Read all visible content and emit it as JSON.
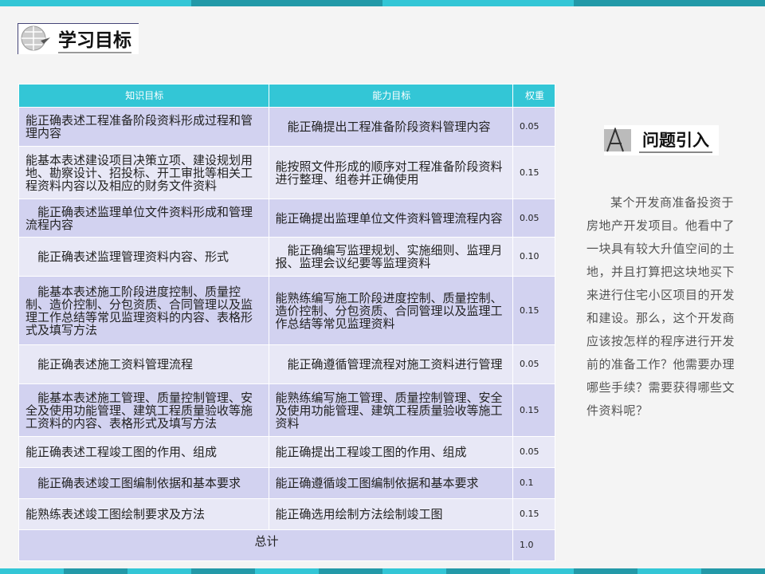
{
  "header": {
    "title": "学习目标"
  },
  "table": {
    "headers": [
      "知识目标",
      "能力目标",
      "权重"
    ],
    "rows": [
      {
        "knowledge": "能正确表述工程准备阶段资料形成过程和管理内容",
        "ability": "　能正确提出工程准备阶段资料管理内容",
        "weight": "0.05"
      },
      {
        "knowledge": "能基本表述建设项目决策立项、建设规划用地、勘察设计、招投标、开工审批等相关工程资料内容以及相应的财务文件资料",
        "ability": "能按照文件形成的顺序对工程准备阶段资料进行整理、组卷并正确使用",
        "weight": "0.15"
      },
      {
        "knowledge": "　能正确表述监理单位文件资料形成和管理流程内容",
        "ability": "能正确提出监理单位文件资料管理流程内容",
        "weight": "0.05"
      },
      {
        "knowledge": "　能正确表述监理管理资料内容、形式",
        "ability": "　能正确编写监理规划、实施细则、监理月报、监理会议纪要等监理资料",
        "weight": "0.10"
      },
      {
        "knowledge": "　能基本表述施工阶段进度控制、质量控制、造价控制、分包资质、合同管理以及监理工作总结等常见监理资料的内容、表格形式及填写方法",
        "ability": "能熟练编写施工阶段进度控制、质量控制、造价控制、分包资质、合同管理以及监理工作总结等常见监理资料",
        "weight": "0.15"
      },
      {
        "knowledge": "　能正确表述施工资料管理流程",
        "ability": "　能正确遵循管理流程对施工资料进行管理",
        "weight": "0.05"
      },
      {
        "knowledge": "　能基本表述施工管理、质量控制管理、安全及使用功能管理、建筑工程质量验收等施工资料的内容、表格形式及填写方法",
        "ability": "能熟练编写施工管理、质量控制管理、安全及使用功能管理、建筑工程质量验收等施工资料",
        "weight": "0.15"
      },
      {
        "knowledge": "能正确表述工程竣工图的作用、组成",
        "ability": "能正确提出工程竣工图的作用、组成",
        "weight": "0.05"
      },
      {
        "knowledge": "　能正确表述竣工图编制依据和基本要求",
        "ability": "能正确遵循竣工图编制依据和基本要求",
        "weight": "0.1"
      },
      {
        "knowledge": "能熟练表述竣工图绘制要求及方法",
        "ability": "能正确选用绘制方法绘制竣工图",
        "weight": "0.15"
      }
    ],
    "total_label": "总计",
    "total_weight": "1.0"
  },
  "sidebar": {
    "title": "问题引入",
    "story": "某个开发商准备投资于房地产开发项目。他看中了一块具有较大升值空间的土地，并且打算把这块地买下来进行住宅小区项目的开发和建设。那么，这个开发商应该按怎样的程序进行开发前的准备工作？他需要办理哪些手续？需要获得哪些文件资料呢？"
  },
  "colors": {
    "accent": "#33c6d6",
    "accent_dark": "#2399a8",
    "row_a": "#d2d2f0",
    "row_b": "#e8e8f6"
  }
}
